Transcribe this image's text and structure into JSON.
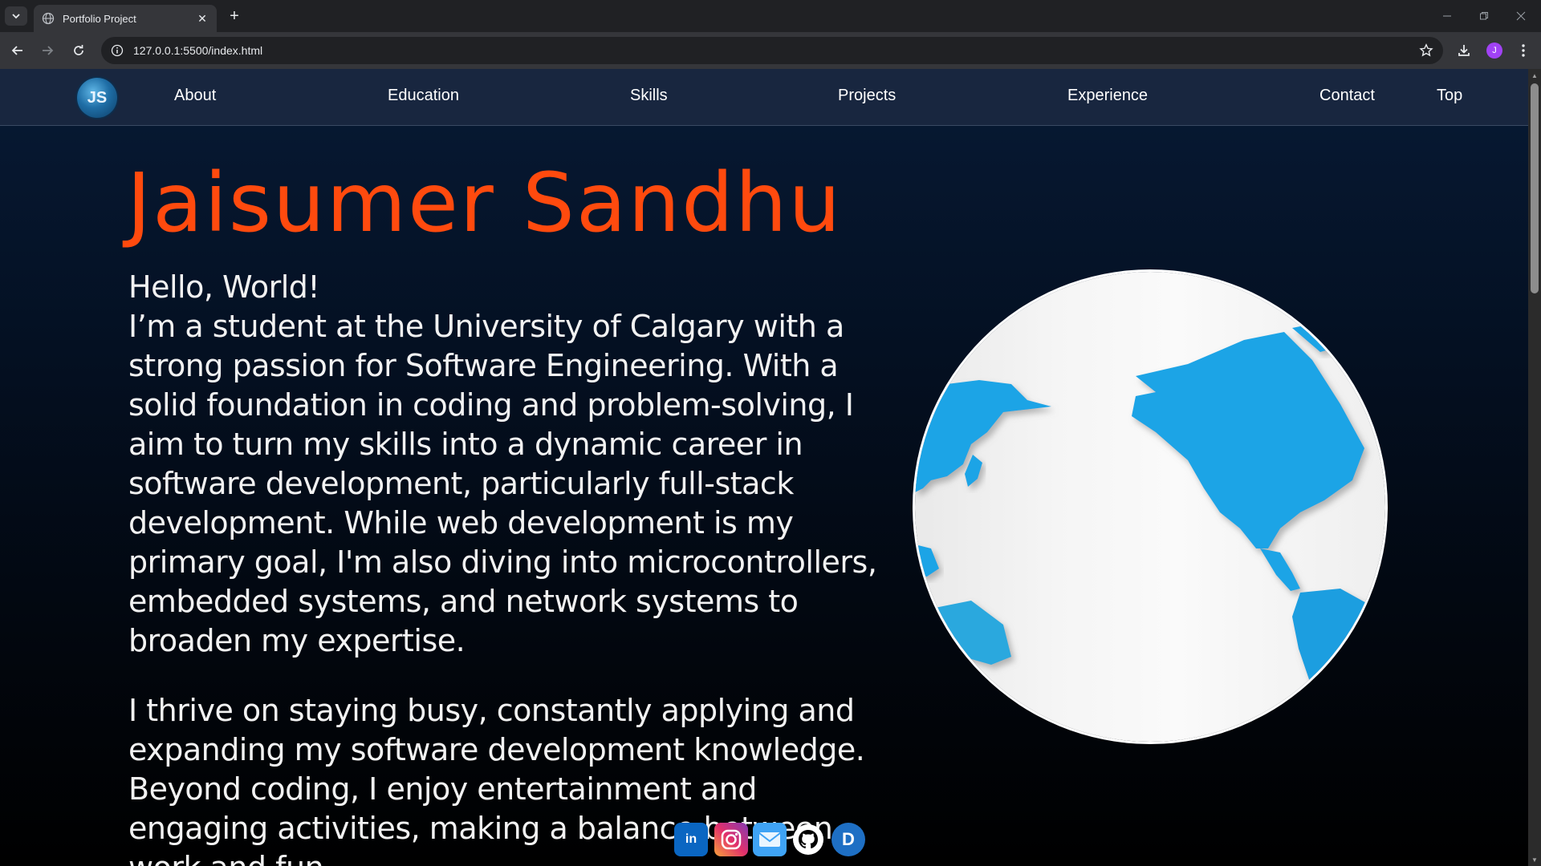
{
  "browser": {
    "tab_title": "Portfolio Project",
    "url": "127.0.0.1:5500/index.html",
    "profile_initial": "J"
  },
  "nav": {
    "logo_text": "JS",
    "links": [
      "About",
      "Education",
      "Skills",
      "Projects",
      "Experience",
      "Contact",
      "Top"
    ]
  },
  "hero": {
    "name": "Jaisumer Sandhu",
    "greeting": "Hello, World!",
    "intro": "I’m a student at the University of Calgary with a strong passion for Software Engineering. With a solid foundation in coding and problem-solving, I aim to turn my skills into a dynamic career in software development, particularly full-stack development. While web development is my primary goal, I'm also diving into microcontrollers, embedded systems, and network systems to broaden my expertise.",
    "para2": "I thrive on staying busy, constantly applying and expanding my software development knowledge. Beyond coding, I enjoy entertainment and engaging activities, making a balance between work and fun"
  },
  "social": {
    "linkedin": "in",
    "devpost": "D"
  },
  "colors": {
    "accent": "#ff4a0e",
    "nav_bg": "#18263f"
  }
}
